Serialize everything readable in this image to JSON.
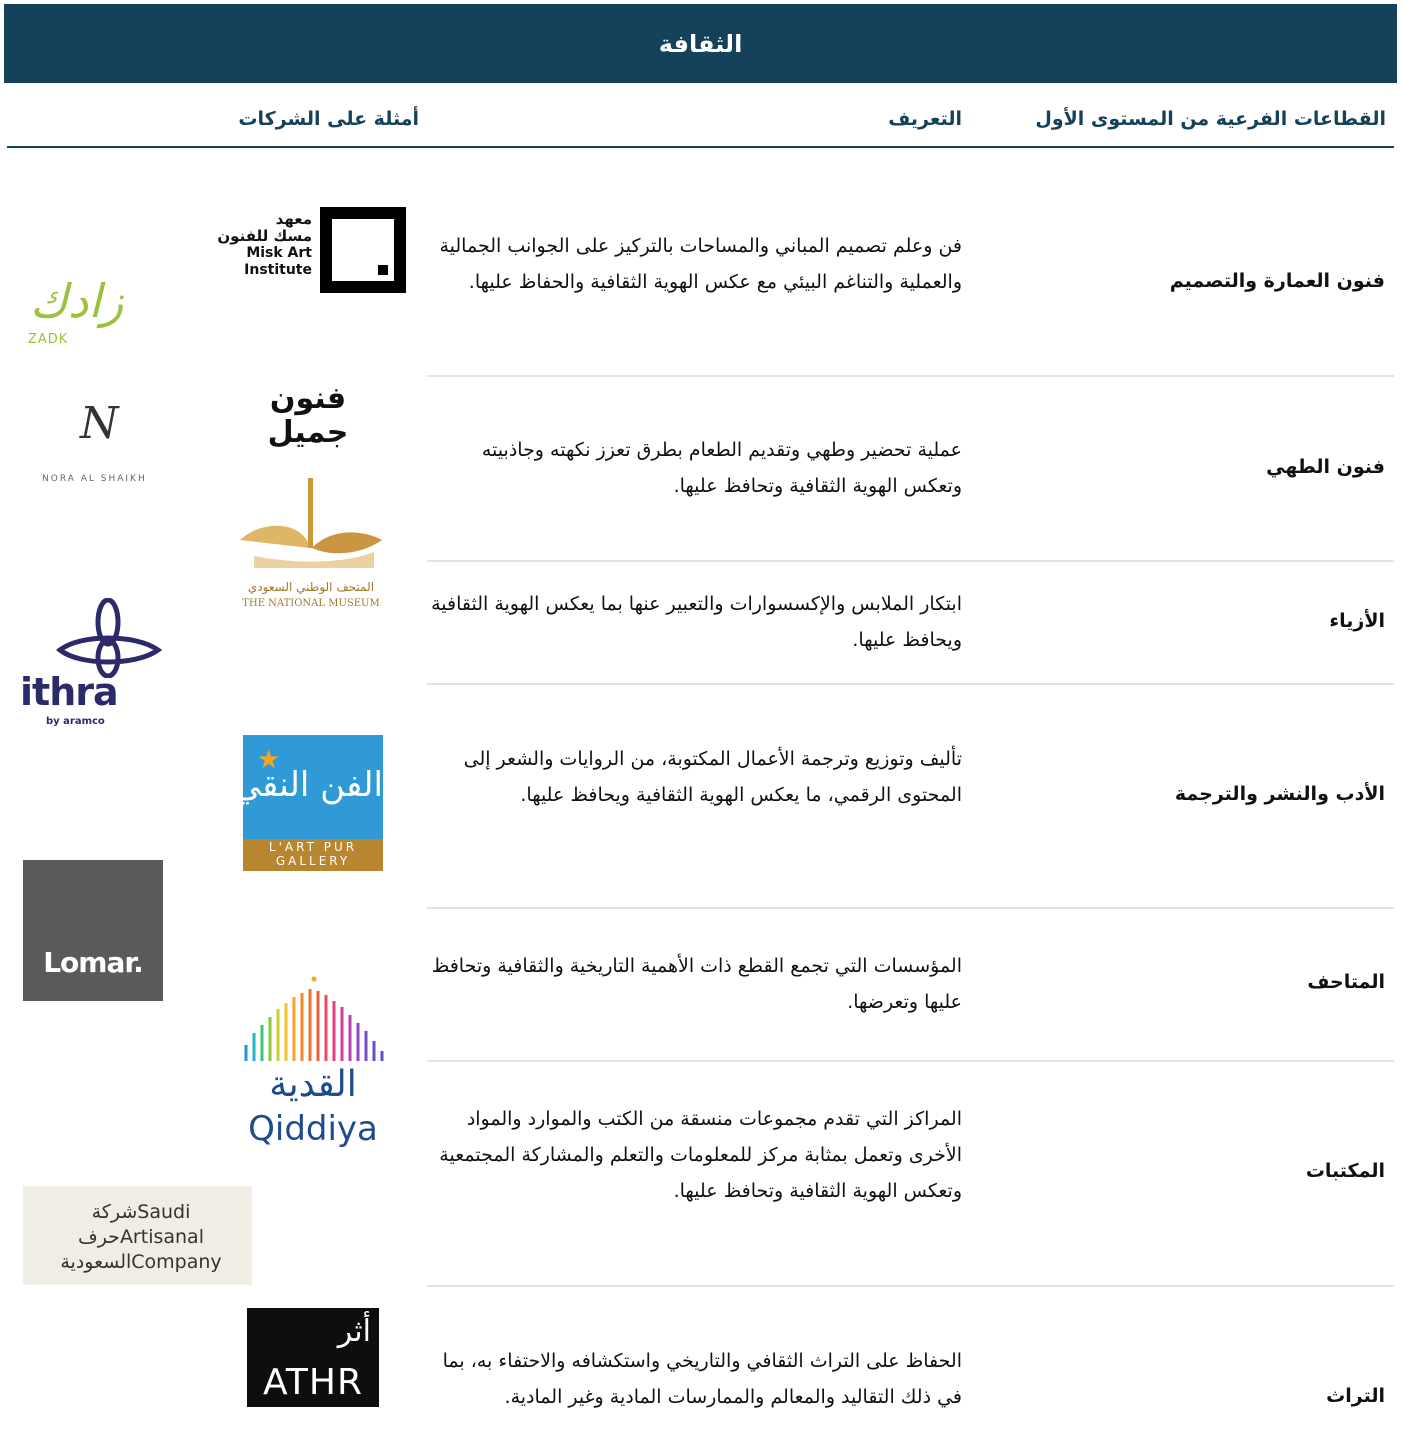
{
  "title": "الثقافة",
  "headers": {
    "sectors": "القطاعات الفرعية من المستوى الأول",
    "definition": "التعريف",
    "examples": "أمثلة على الشركات"
  },
  "rows": [
    {
      "sector": "فنون العمارة والتصميم",
      "definition": "فن وعلم تصميم المباني والمساحات بالتركيز على الجوانب الجمالية والعملية والتناغم البيئي مع عكس الهوية الثقافية والحفاظ عليها."
    },
    {
      "sector": "فنون الطهي",
      "definition": "عملية تحضير وطهي وتقديم الطعام بطرق تعزز نكهته وجاذبيته وتعكس الهوية الثقافية وتحافظ عليها."
    },
    {
      "sector": "الأزياء",
      "definition": "ابتكار الملابس والإكسسوارات والتعبير عنها بما يعكس الهوية الثقافية ويحافظ عليها."
    },
    {
      "sector": "الأدب والنشر والترجمة",
      "definition": "تأليف وتوزيع وترجمة الأعمال المكتوبة، من الروايات والشعر إلى المحتوى الرقمي، ما يعكس الهوية الثقافية ويحافظ عليها."
    },
    {
      "sector": "المتاحف",
      "definition": "المؤسسات التي تجمع القطع ذات الأهمية التاريخية والثقافية وتحافظ عليها وتعرضها."
    },
    {
      "sector": "المكتبات",
      "definition": "المراكز التي تقدم مجموعات منسقة من الكتب والموارد والمواد الأخرى وتعمل بمثابة مركز للمعلومات والتعلم والمشاركة المجتمعية وتعكس الهوية الثقافية وتحافظ عليها."
    },
    {
      "sector": "التراث",
      "definition": "الحفاظ على التراث الثقافي والتاريخي واستكشافه والاحتفاء به، بما في ذلك التقاليد والمعالم والممارسات المادية وغير المادية."
    }
  ],
  "logos": {
    "misk": {
      "line1": "معهد",
      "line2": "مسك للفنون",
      "line3": "Misk Art",
      "line4": "Institute"
    },
    "zadk": {
      "arabic": "زادك",
      "latin": "ZADK"
    },
    "funun": {
      "text": "فنون جميل"
    },
    "nora": {
      "mark": "N",
      "text": "NORA AL SHAIKH"
    },
    "museum": {
      "arabic": "المتحف الوطني السعودي",
      "latin": "THE NATIONAL MUSEUM"
    },
    "ithra": {
      "word": "ithra",
      "sub": "by aramco"
    },
    "lartpur": {
      "arabic": "الفن النقي",
      "line1": "L'ART PUR",
      "line2": "GALLERY"
    },
    "lomar": {
      "text": "Lomar."
    },
    "qiddiya": {
      "arabic": "القدية",
      "latin": "Qiddiya"
    },
    "sac": {
      "a1": "شركة",
      "a2": "حرف",
      "a3": "السعودية",
      "e1": "Saudi",
      "e2": "Artisanal",
      "e3": "Company"
    },
    "athr": {
      "arabic": "أثر",
      "latin": "ATHR"
    }
  },
  "colors": {
    "banner": "#15425a",
    "header_text": "#15425a",
    "zadk": "#9bc23c",
    "ithra": "#2b2a6b",
    "lartpur_blue": "#2f9ad6",
    "lartpur_brown": "#b8862f",
    "lomar_bg": "#5a5a5a"
  }
}
